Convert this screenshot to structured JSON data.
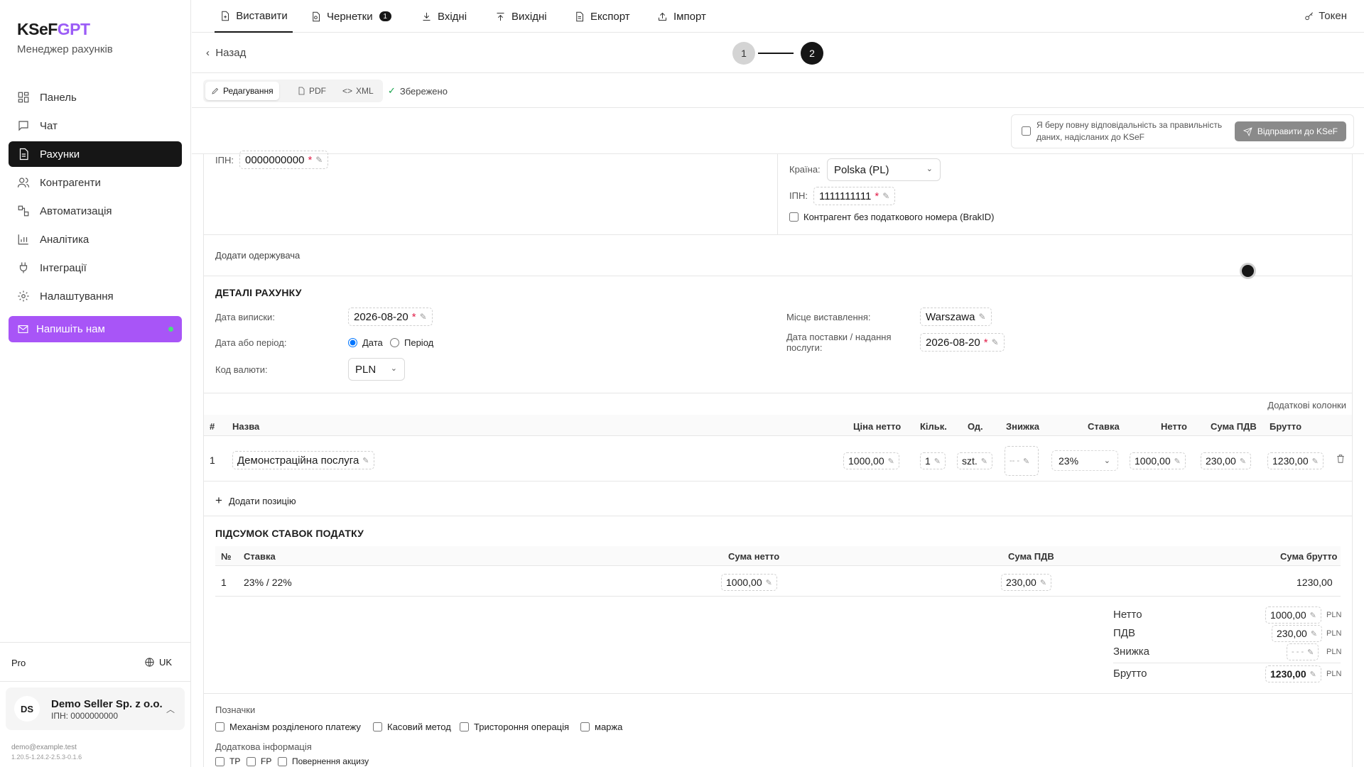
{
  "brand": {
    "name_a": "KSeF",
    "name_b": "GPT",
    "subtitle": "Менеджер рахунків",
    "accent": "#9b5cf6"
  },
  "sidebar": {
    "items": [
      {
        "label": "Панель",
        "icon": "dashboard-icon"
      },
      {
        "label": "Чат",
        "icon": "chat-icon"
      },
      {
        "label": "Рахунки",
        "icon": "invoice-icon",
        "active": true
      },
      {
        "label": "Контрагенти",
        "icon": "users-icon"
      },
      {
        "label": "Автоматизація",
        "icon": "workflow-icon"
      },
      {
        "label": "Аналітика",
        "icon": "chart-icon"
      },
      {
        "label": "Інтеграції",
        "icon": "plug-icon"
      },
      {
        "label": "Налаштування",
        "icon": "gear-icon"
      }
    ],
    "write_us": "Напишіть нам",
    "plan": "Pro",
    "lang": "UK",
    "account": {
      "initials": "DS",
      "name": "Demo Seller Sp. z o.o.",
      "nip": "ІПН: 0000000000"
    },
    "email": "demo@example.test",
    "version": "1.20.5-1.24.2-2.5.3-0.1.6"
  },
  "topbar": {
    "tabs": [
      "Виставити",
      "Чернетки",
      "Вхідні",
      "Вихідні",
      "Експорт",
      "Імпорт"
    ],
    "drafts_count": "1",
    "token": "Токен"
  },
  "backbar": {
    "back": "Назад",
    "step1": "1",
    "step2": "2"
  },
  "mode": {
    "edit": "Редагування",
    "pdf": "PDF",
    "xml": "XML",
    "saved": "Збережено"
  },
  "send": {
    "consent": "Я беру повну відповідальність за правильність даних, надісланих до KSeF",
    "button": "Відправити до KSeF"
  },
  "seller": {
    "nip_label": "ІПН:",
    "nip": "0000000000"
  },
  "buyer": {
    "country_label": "Країна:",
    "country": "Polska (PL)",
    "nip_label": "ІПН:",
    "nip": "1111111111",
    "no_tax_id": "Контрагент без податкового номера (BrakID)"
  },
  "add_recipient": "Додати одержувача",
  "details": {
    "title": "ДЕТАЛІ РАХУНКУ",
    "issue_date_label": "Дата виписки:",
    "issue_date": "2026-08-20",
    "date_or_period_label": "Дата або період:",
    "opt_date": "Дата",
    "opt_period": "Період",
    "currency_label": "Код валюти:",
    "currency": "PLN",
    "place_label": "Місце виставлення:",
    "place": "Warszawa",
    "delivery_label": "Дата поставки / надання послуги:",
    "delivery_date": "2026-08-20"
  },
  "items": {
    "extra_columns": "Додаткові колонки",
    "headers": {
      "num": "#",
      "name": "Назва",
      "net_price": "Ціна нетто",
      "qty": "Кільк.",
      "unit": "Од.",
      "discount": "Знижка",
      "rate": "Ставка",
      "net": "Нетто",
      "vat": "Сума ПДВ",
      "gross": "Брутто"
    },
    "rows": [
      {
        "num": "1",
        "name": "Демонстраційна послуга",
        "net_price": "1000,00",
        "qty": "1",
        "unit": "szt.",
        "discount": "-- -",
        "rate": "23%",
        "net": "1000,00",
        "vat": "230,00",
        "gross": "1230,00"
      }
    ],
    "add_position": "Додати позицію"
  },
  "tax_summary": {
    "title": "ПІДСУМОК СТАВОК ПОДАТКУ",
    "headers": {
      "num": "№",
      "rate": "Ставка",
      "net": "Сума нетто",
      "vat": "Сума ПДВ",
      "gross": "Сума брутто"
    },
    "rows": [
      {
        "num": "1",
        "rate": "23% / 22%",
        "net": "1000,00",
        "vat": "230,00",
        "gross": "1230,00"
      }
    ]
  },
  "totals": {
    "net_label": "Нетто",
    "net": "1000,00",
    "vat_label": "ПДВ",
    "vat": "230,00",
    "discount_label": "Знижка",
    "discount": "- - -",
    "gross_label": "Брутто",
    "gross": "1230,00",
    "currency": "PLN"
  },
  "marks": {
    "title": "Позначки",
    "flags": [
      "Механізм розділеного платежу",
      "Касовий метод",
      "Тристороння операція",
      "маржа"
    ],
    "extra_title": "Додаткова інформація",
    "extra_flags": [
      "TP",
      "FP",
      "Повернення акцизу"
    ]
  }
}
